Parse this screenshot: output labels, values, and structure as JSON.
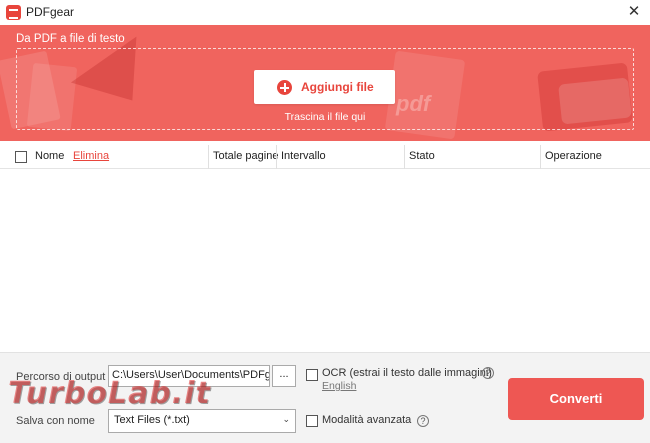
{
  "window": {
    "title": "PDFgear",
    "close_glyph": "✕"
  },
  "banner": {
    "title": "Da PDF a file di testo",
    "add_button_label": "Aggiungi file",
    "drop_hint": "Trascina il file qui",
    "deco_text": "pdf",
    "accent_color": "#e8453c"
  },
  "table": {
    "columns": {
      "name": "Nome",
      "delete": "Elimina",
      "pages": "Totale pagine",
      "range": "Intervallo",
      "status": "Stato",
      "operation": "Operazione"
    },
    "rows": []
  },
  "output": {
    "path_label": "Percorso di output",
    "path_value": "C:\\Users\\User\\Documents\\PDFgear",
    "browse_label": "...",
    "save_as_label": "Salva con nome",
    "save_as_value": "Text Files (*.txt)",
    "ocr_label": "OCR (estrai il testo dalle immagini)",
    "ocr_language": "English",
    "advanced_label": "Modalità avanzata",
    "convert_label": "Converti"
  },
  "watermark": "TurboLab.it"
}
